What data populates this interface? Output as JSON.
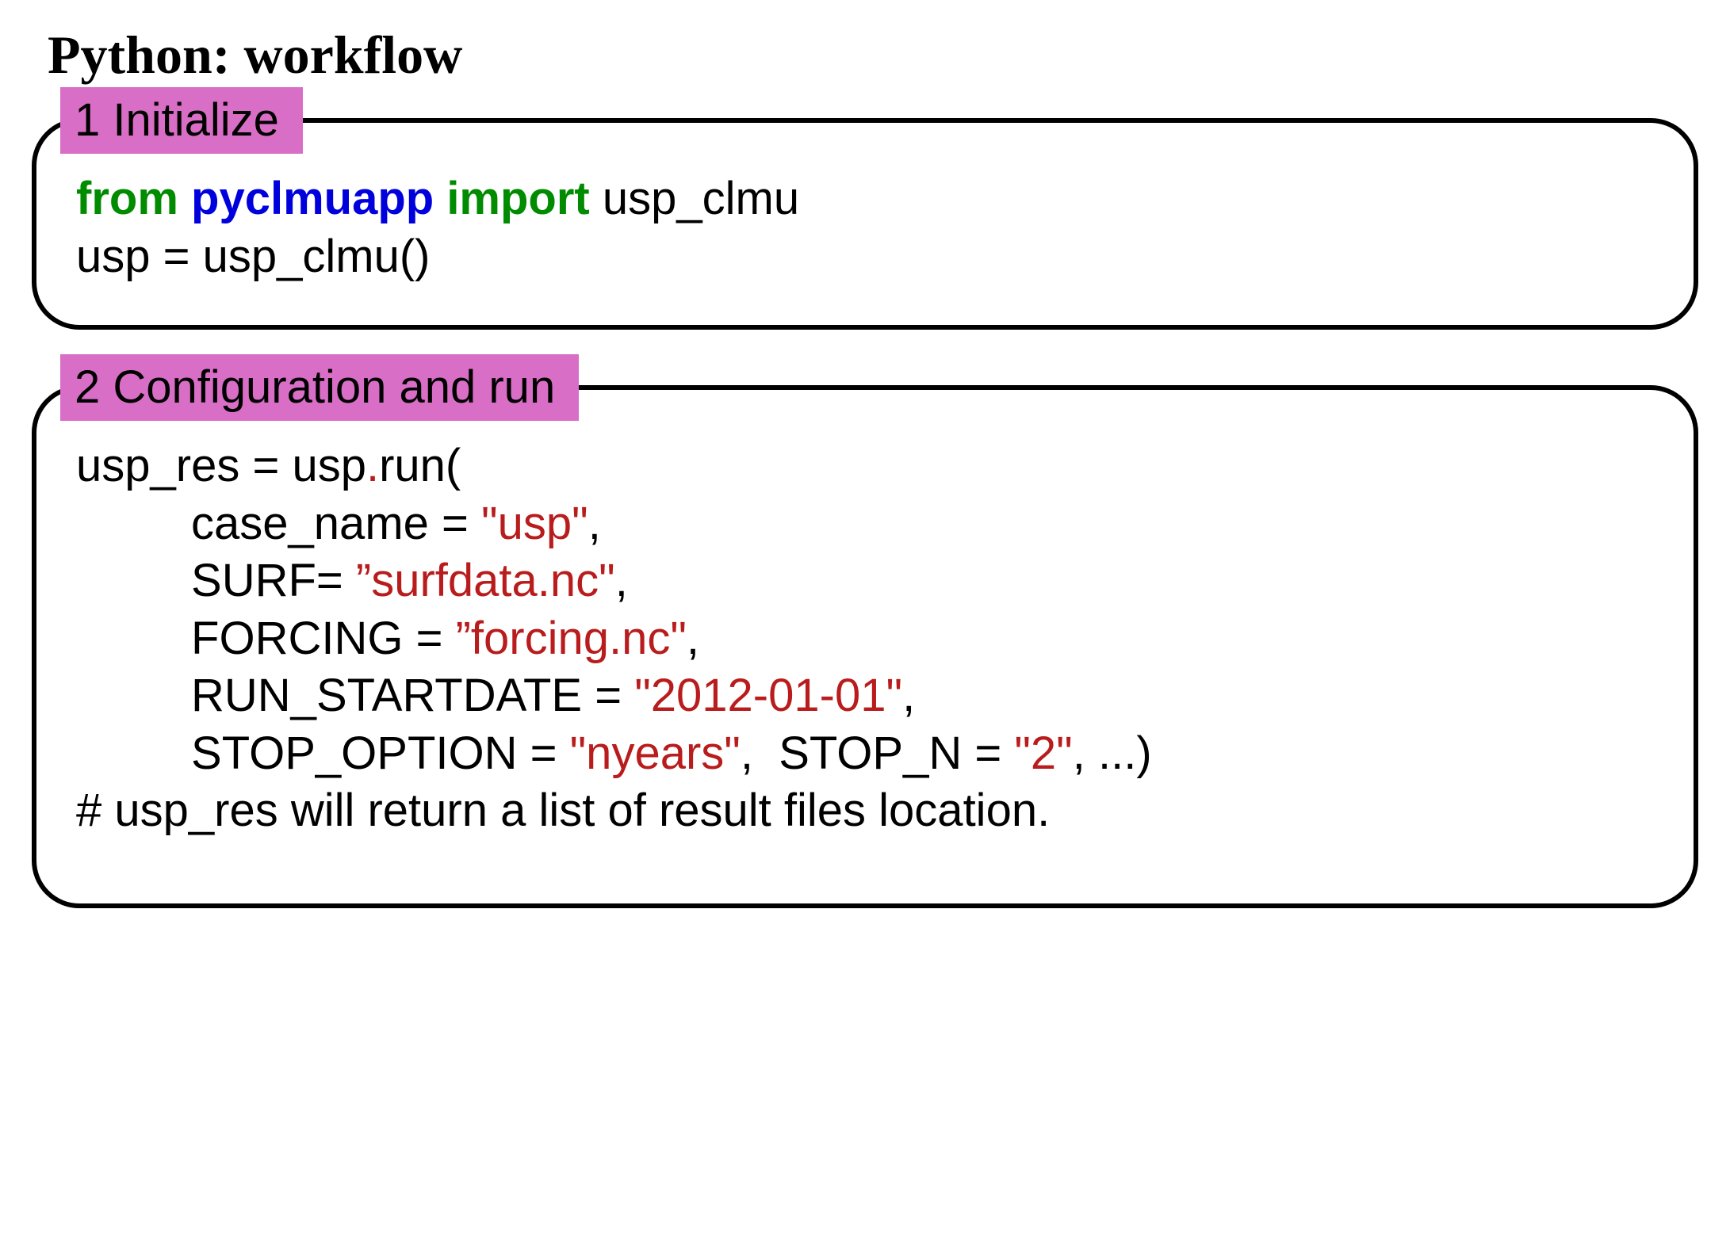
{
  "title": "Python: workflow",
  "sections": {
    "s1": {
      "label": "1 Initialize",
      "code": {
        "from": "from",
        "module": "pyclmuapp",
        "import": "import",
        "symbol": " usp_clmu",
        "line2": "usp = usp_clmu()"
      }
    },
    "s2": {
      "label": "2 Configuration and run",
      "code": {
        "l1a": "usp_res = usp",
        "l1dot": ".",
        "l1b": "run(",
        "l2a": "         case_name = ",
        "l2b": "\"usp\"",
        "l2c": ",",
        "l3a": "         SURF= ",
        "l3b": "”surfdata.nc\"",
        "l3c": ",",
        "l4a": "         FORCING = ",
        "l4b": "”forcing.nc\"",
        "l4c": ",",
        "l5a": "         RUN_STARTDATE = ",
        "l5b": "\"2012-01-01\"",
        "l5c": ",",
        "l6a": "         STOP_OPTION = ",
        "l6b": "\"nyears\"",
        "l6c": ",  STOP_N = ",
        "l6d": "\"2\"",
        "l6e": ", ...)",
        "l7": "# usp_res will return a list of result files location."
      }
    }
  }
}
